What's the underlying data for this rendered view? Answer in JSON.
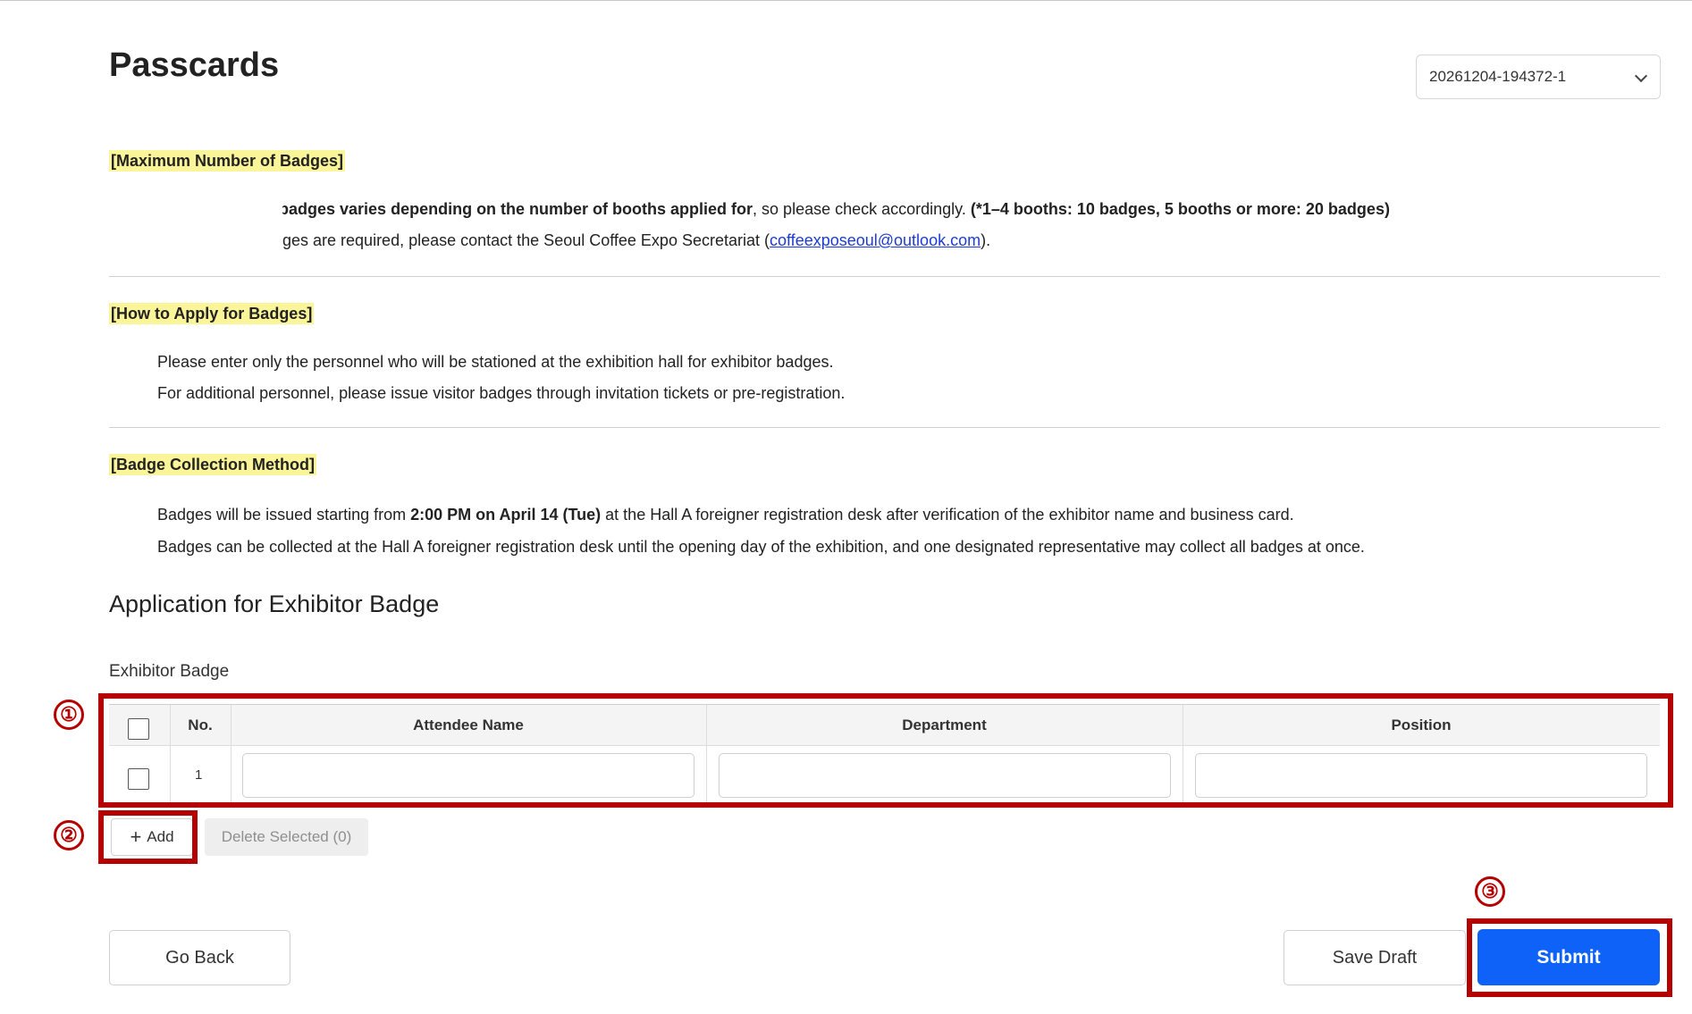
{
  "page": {
    "title": "Passcards",
    "application_id": "20261204-194372-1"
  },
  "sections": {
    "max_badges": {
      "heading": "[Maximum Number of Badges]",
      "line1_bold": "badges varies depending on the number of booths applied for",
      "line1_rest": ", so please check accordingly. ",
      "line1_bold2": "(*1–4 booths: 10 badges, 5 booths or more: 20 badges)",
      "line2_pre": "ges are required, please contact the Seoul Coffee Expo Secretariat (",
      "line2_link": "coffeexposeoul@outlook.com",
      "line2_post": ")."
    },
    "how_to_apply": {
      "heading": "[How to Apply for Badges]",
      "line1": "Please enter only the personnel who will be stationed at the exhibition hall for exhibitor badges.",
      "line2": "For additional personnel, please issue visitor badges through invitation tickets or pre-registration."
    },
    "collection": {
      "heading": "[Badge Collection Method]",
      "line1_pre": "Badges will be issued starting from ",
      "line1_bold": "2:00 PM on April 14 (Tue)",
      "line1_post": " at the Hall A foreigner registration desk after verification of the exhibitor name and business card.",
      "line2": "Badges can be collected at the Hall A foreigner registration desk until the opening day of the exhibition, and one designated representative may collect all badges at once."
    }
  },
  "form": {
    "title": "Application for Exhibitor Badge",
    "table_label": "Exhibitor Badge",
    "columns": [
      "No.",
      "Attendee Name",
      "Department",
      "Position"
    ],
    "rows": [
      {
        "no": "1",
        "attendee_name": "",
        "department": "",
        "position": ""
      }
    ],
    "add_label": "Add",
    "delete_label": "Delete Selected (0)"
  },
  "actions": {
    "back_label": "Go Back",
    "draft_label": "Save Draft",
    "submit_label": "Submit"
  },
  "annotations": [
    "①",
    "②",
    "③"
  ],
  "colors": {
    "accent": "#0f62f7",
    "highlight": "#fbf59a",
    "annotation": "#b50000",
    "link": "#1d3bd6"
  }
}
